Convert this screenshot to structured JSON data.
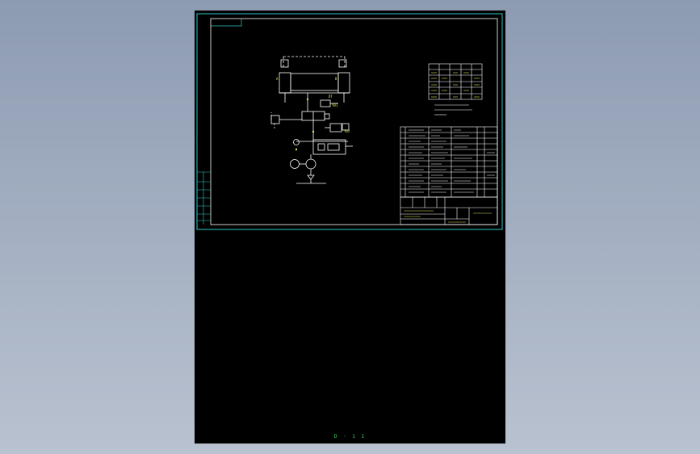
{
  "viewer": {
    "background_top": "#8d9bb2",
    "background_bottom": "#b9c2d0",
    "sheet_color": "#000000"
  },
  "drawing": {
    "frame_color": "#2fc8c8",
    "line_color": "#ffffff",
    "accent_color": "#e6e65a",
    "label_a": "A",
    "label_b": "B",
    "label_dt": "DT",
    "label_yb1": "YB1",
    "label_yb2": "YB2"
  },
  "status": {
    "page_indicator": "D · 1 1",
    "indicator_color": "#3fdc5a"
  }
}
